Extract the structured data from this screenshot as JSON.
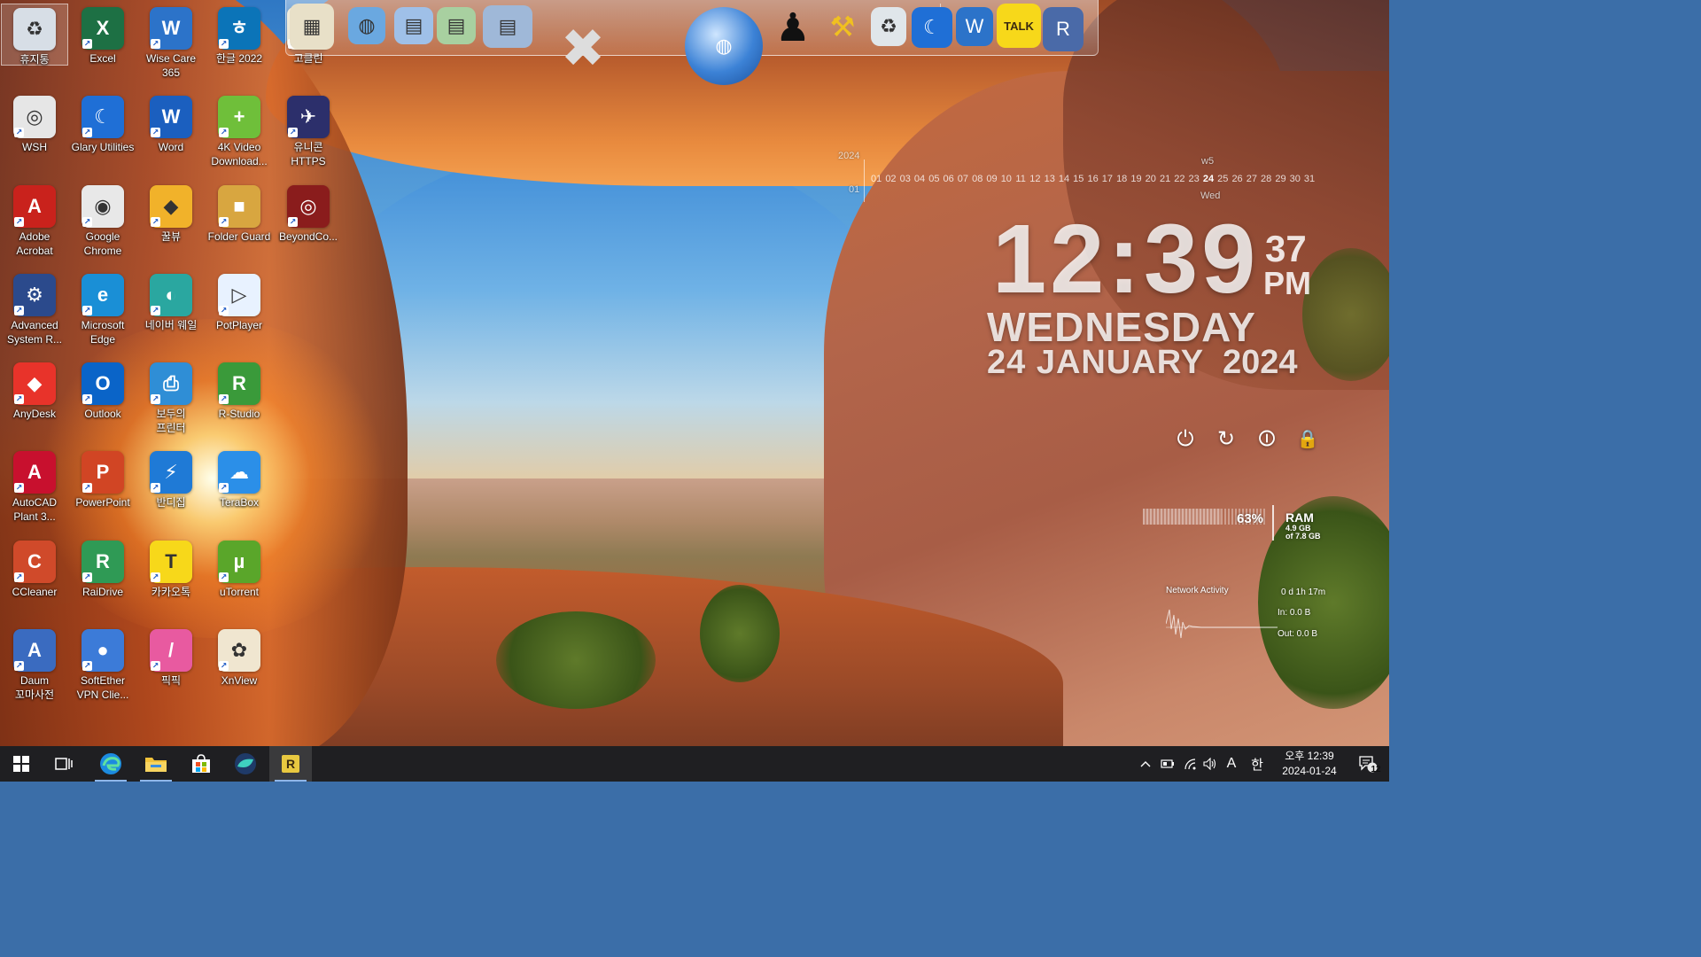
{
  "desktop": {
    "icons": [
      {
        "label": "휴지통",
        "icon": "recycle-bin-icon",
        "color": "#d7dee6",
        "glyph": "♻"
      },
      {
        "label": "Excel",
        "icon": "excel-icon",
        "color": "#1d7044",
        "glyph": "X"
      },
      {
        "label": "Wise Care\n365",
        "icon": "wise-care-icon",
        "color": "#2c73c9",
        "glyph": "W"
      },
      {
        "label": "한글 2022",
        "icon": "hangul-icon",
        "color": "#0b74b8",
        "glyph": "ㅎ"
      },
      {
        "label": "고클린",
        "icon": "goclean-icon",
        "color": "#e9e2c8",
        "glyph": "G"
      },
      {
        "label": "WSH",
        "icon": "wsh-icon",
        "color": "#e6e6e6",
        "glyph": "◎"
      },
      {
        "label": "Glary Utilities",
        "icon": "glary-utilities-icon",
        "color": "#1f6fd6",
        "glyph": "☾"
      },
      {
        "label": "Word",
        "icon": "word-icon",
        "color": "#1b5fbf",
        "glyph": "W"
      },
      {
        "label": "4K Video\nDownload...",
        "icon": "4k-video-downloader-icon",
        "color": "#6fbf3a",
        "glyph": "+"
      },
      {
        "label": "유니콘\nHTTPS",
        "icon": "unicorn-https-icon",
        "color": "#2c2f6b",
        "glyph": "✈"
      },
      {
        "label": "Adobe\nAcrobat",
        "icon": "adobe-acrobat-icon",
        "color": "#c9221c",
        "glyph": "A"
      },
      {
        "label": "Google\nChrome",
        "icon": "google-chrome-icon",
        "color": "#e8e8e8",
        "glyph": "◉"
      },
      {
        "label": "꿀뷰",
        "icon": "honeyview-icon",
        "color": "#f1b22a",
        "glyph": "◆"
      },
      {
        "label": "Folder Guard",
        "icon": "folder-guard-icon",
        "color": "#d8a640",
        "glyph": "■"
      },
      {
        "label": "BeyondCo...",
        "icon": "beyond-compare-icon",
        "color": "#8a1c1c",
        "glyph": "◎"
      },
      {
        "label": "Advanced\nSystem R...",
        "icon": "advanced-system-repair-icon",
        "color": "#2b4a8c",
        "glyph": "⚙"
      },
      {
        "label": "Microsoft\nEdge",
        "icon": "microsoft-edge-icon",
        "color": "#1a8fd6",
        "glyph": "e"
      },
      {
        "label": "네이버 웨일",
        "icon": "naver-whale-icon",
        "color": "#2aa7a0",
        "glyph": "◐"
      },
      {
        "label": "PotPlayer",
        "icon": "potplayer-icon",
        "color": "#e8f2ff",
        "glyph": "▷"
      },
      {
        "label": "AnyDesk",
        "icon": "anydesk-icon",
        "color": "#e8332a",
        "glyph": "◆"
      },
      {
        "label": "Outlook",
        "icon": "outlook-icon",
        "color": "#0a64c8",
        "glyph": "O"
      },
      {
        "label": "보두의\n프린터",
        "icon": "printer-icon",
        "color": "#2f8ed6",
        "glyph": "⎙"
      },
      {
        "label": "R-Studio",
        "icon": "r-studio-icon",
        "color": "#3a9a3a",
        "glyph": "R"
      },
      {
        "label": "AutoCAD\nPlant 3...",
        "icon": "autocad-plant3d-icon",
        "color": "#c8102e",
        "glyph": "A"
      },
      {
        "label": "PowerPoint",
        "icon": "powerpoint-icon",
        "color": "#d14524",
        "glyph": "P"
      },
      {
        "label": "반디집",
        "icon": "bandizip-icon",
        "color": "#1f7ad6",
        "glyph": "⚡"
      },
      {
        "label": "TeraBox",
        "icon": "terabox-icon",
        "color": "#2b8fe8",
        "glyph": "☁"
      },
      {
        "label": "CCleaner",
        "icon": "ccleaner-icon",
        "color": "#d04a2a",
        "glyph": "C"
      },
      {
        "label": "RaiDrive",
        "icon": "raidrive-icon",
        "color": "#2f9a55",
        "glyph": "R"
      },
      {
        "label": "카카오톡",
        "icon": "kakaotalk-icon",
        "color": "#f7d81a",
        "glyph": "T"
      },
      {
        "label": "uTorrent",
        "icon": "utorrent-icon",
        "color": "#5aa62a",
        "glyph": "µ"
      },
      {
        "label": "Daum\n꼬마사전",
        "icon": "daum-dictionary-icon",
        "color": "#3a6bc0",
        "glyph": "A"
      },
      {
        "label": "SoftEther\nVPN Clie...",
        "icon": "softether-vpn-icon",
        "color": "#3c7bd8",
        "glyph": "●"
      },
      {
        "label": "픽픽",
        "icon": "picpick-icon",
        "color": "#e85aa0",
        "glyph": "/"
      },
      {
        "label": "XnView",
        "icon": "xnview-icon",
        "color": "#f0e6d0",
        "glyph": "✿"
      }
    ]
  },
  "dock": {
    "items": [
      {
        "icon": "photo-viewer-icon",
        "color": "#e8e0c8",
        "glyph": "▦"
      },
      {
        "icon": "web-globe-icon",
        "color": "#6aa8e0",
        "glyph": "◍"
      },
      {
        "icon": "folder-icon",
        "color": "#9fc0e8",
        "glyph": "▤"
      },
      {
        "icon": "folder-green-icon",
        "color": "#a8d0a0",
        "glyph": "▤"
      },
      {
        "icon": "folder-disk-icon",
        "color": "#9fb8d8",
        "glyph": "▤"
      },
      {
        "icon": "system-tools-icon",
        "color": "#c8c8c8",
        "glyph": "✖"
      },
      {
        "icon": "internet-globe-icon",
        "color": "#3c82d6",
        "glyph": "◍"
      },
      {
        "icon": "tshirt-icon",
        "color": "#111111",
        "glyph": "♟"
      },
      {
        "icon": "hammer-tool-icon",
        "color": "#f0c020",
        "glyph": "⚒"
      },
      {
        "icon": "recycle-bin-icon",
        "color": "#e0e6ea",
        "glyph": "♻"
      },
      {
        "icon": "glary-utilities-icon",
        "color": "#1f6fd6",
        "glyph": "☾"
      },
      {
        "icon": "wise-care-icon",
        "color": "#2c73c9",
        "glyph": "W"
      },
      {
        "icon": "kakaotalk-icon",
        "color": "#f7d81a",
        "glyph": "T"
      },
      {
        "icon": "r-launcher-icon",
        "color": "#4a6aa8",
        "glyph": "R"
      }
    ],
    "kakao_label": "TALK"
  },
  "calendar": {
    "year": "2024",
    "month": "01",
    "days": [
      "01",
      "02",
      "03",
      "04",
      "05",
      "06",
      "07",
      "08",
      "09",
      "10",
      "11",
      "12",
      "13",
      "14",
      "15",
      "16",
      "17",
      "18",
      "19",
      "20",
      "21",
      "22",
      "23",
      "24",
      "25",
      "26",
      "27",
      "28",
      "29",
      "30",
      "31"
    ],
    "today": "24",
    "week": "w5",
    "weekday": "Wed"
  },
  "clock": {
    "time": "12:39",
    "seconds": "37",
    "ampm": "PM",
    "day": "WEDNESDAY",
    "date": "24 JANUARY",
    "year": "2024"
  },
  "power_buttons": [
    {
      "name": "power-off-icon",
      "glyph": "⏻"
    },
    {
      "name": "restart-icon",
      "glyph": "↻"
    },
    {
      "name": "shutdown-icon",
      "glyph": "⏼"
    },
    {
      "name": "lock-icon",
      "glyph": "🔒"
    }
  ],
  "ram": {
    "percent_value": 63,
    "percent": "63%",
    "label": "RAM",
    "used": "4.9 GB",
    "total": "of 7.8 GB"
  },
  "network": {
    "title": "Network Activity",
    "uptime": "0 d 1h 17m",
    "in": "In: 0.0 B",
    "out": "Out: 0.0 B"
  },
  "taskbar": {
    "apps": [
      {
        "icon": "windows-start-icon"
      },
      {
        "icon": "task-view-icon"
      },
      {
        "icon": "microsoft-edge-icon"
      },
      {
        "icon": "file-explorer-icon"
      },
      {
        "icon": "microsoft-store-icon"
      },
      {
        "icon": "naver-whale-icon"
      },
      {
        "icon": "r-launcher-icon"
      }
    ],
    "tray": {
      "chevron": "^",
      "ime_a": "A",
      "ime_han": "한"
    },
    "clock": {
      "time": "오후 12:39",
      "date": "2024-01-24"
    },
    "notifications": "12"
  }
}
